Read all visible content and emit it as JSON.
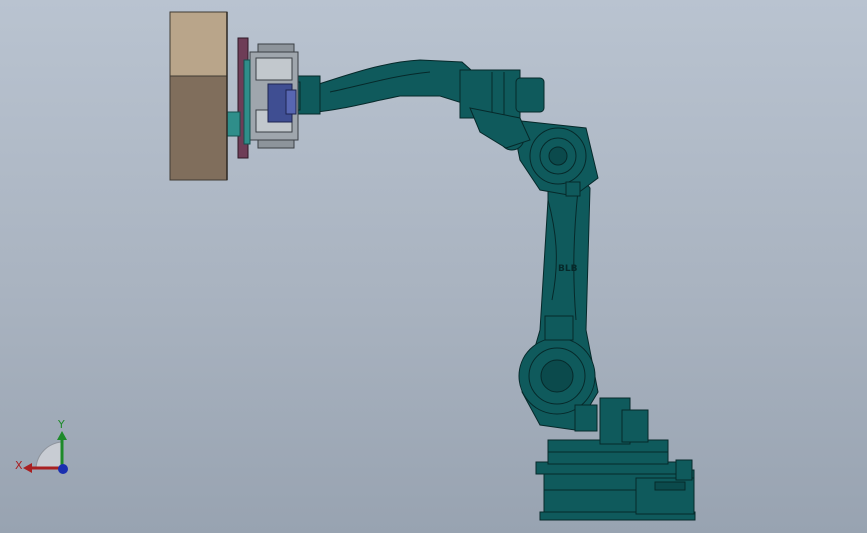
{
  "viewport": {
    "background_top": "#b9c3d0",
    "background_bottom": "#98a3b1"
  },
  "model": {
    "arm_marking": "BLB",
    "robot_color": "#0f5a5c",
    "robot_edge_color": "#06292a",
    "gripper_block_top_color": "#b9a58a",
    "gripper_block_bottom_color": "#806e5c",
    "gripper_frame_color": "#9fa6ad",
    "motor_color": "#3f4e92"
  },
  "triad": {
    "x_label": "X",
    "y_label": "Y",
    "x_color": "#a82022",
    "y_color": "#1e8a2a",
    "z_color": "#1a2fb0"
  }
}
